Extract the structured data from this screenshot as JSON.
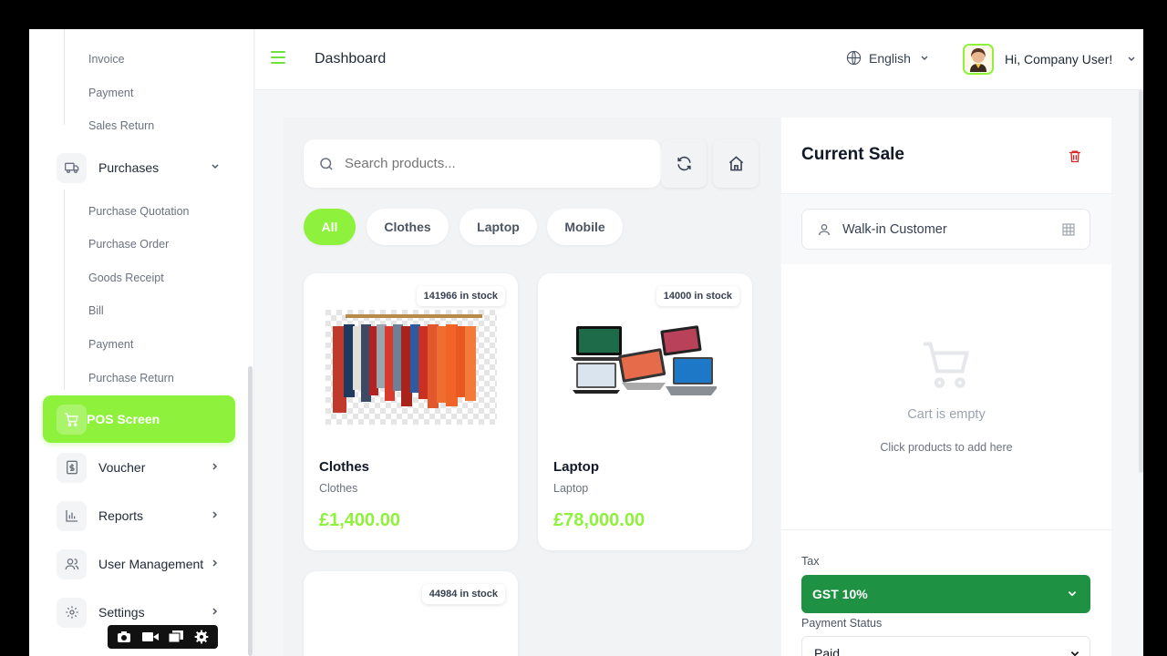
{
  "sidebar": {
    "top_sub_items": [
      "Invoice",
      "Payment",
      "Sales Return"
    ],
    "purchases": {
      "label": "Purchases",
      "icon": "truck-icon"
    },
    "purchase_sub_items": [
      "Purchase Quotation",
      "Purchase Order",
      "Goods Receipt",
      "Bill",
      "Payment",
      "Purchase Return"
    ],
    "pos": {
      "label": "POS Screen",
      "icon": "cart-icon"
    },
    "items": [
      {
        "label": "Voucher",
        "icon": "voucher-icon"
      },
      {
        "label": "Reports",
        "icon": "chart-icon"
      },
      {
        "label": "User Management",
        "icon": "users-icon"
      },
      {
        "label": "Settings",
        "icon": "gear-icon"
      }
    ]
  },
  "header": {
    "title": "Dashboard",
    "language": "English",
    "greeting": "Hi, Company User!"
  },
  "search": {
    "placeholder": "Search products..."
  },
  "filters": [
    "All",
    "Clothes",
    "Laptop",
    "Mobile"
  ],
  "products": [
    {
      "name": "Clothes",
      "category": "Clothes",
      "price": "£1,400.00",
      "stock": "141966 in stock"
    },
    {
      "name": "Laptop",
      "category": "Laptop",
      "price": "£78,000.00",
      "stock": "14000 in stock"
    },
    {
      "stock": "44984 in stock"
    }
  ],
  "sale": {
    "title": "Current Sale",
    "customer": "Walk-in Customer",
    "empty_text": "Cart is empty",
    "empty_hint": "Click products to add here",
    "tax_label": "Tax",
    "tax_value": "GST 10%",
    "payment_status_label": "Payment Status",
    "payment_status_value": "Paid"
  },
  "colors": {
    "accent": "#8ef13b",
    "tax": "#1f9142",
    "danger": "#dc2626"
  }
}
